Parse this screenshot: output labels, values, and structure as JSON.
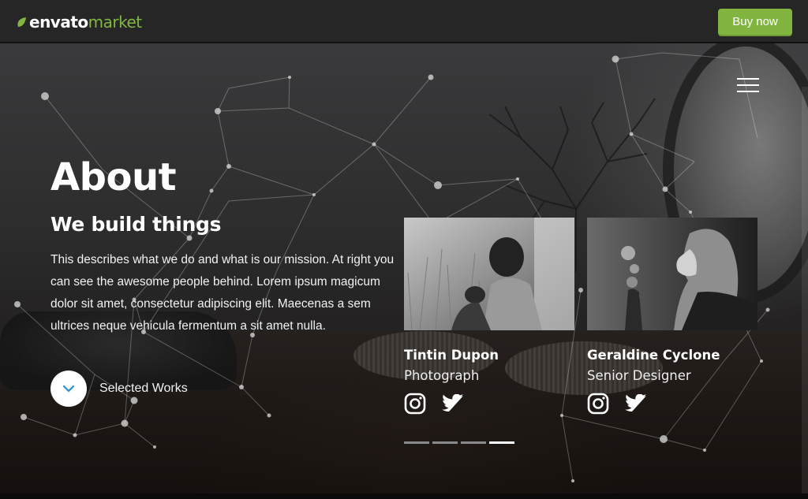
{
  "topbar": {
    "brand_main": "envato",
    "brand_accent": "market",
    "buy_label": "Buy now",
    "accent_color": "#82b440"
  },
  "hero": {
    "title": "About",
    "subtitle": "We build things",
    "description": "This describes what we do and what is our mission. At right you can see the awesome people behind. Lorem ipsum magicum dolor sit amet, consectetur adipiscing elit. Maecenas a sem ultrices neque vehicula fermentum a sit amet nulla.",
    "works_label": "Selected Works",
    "menu_icon": "hamburger-icon"
  },
  "team": [
    {
      "name": "Tintin Dupon",
      "role": "Photograph",
      "socials": [
        "instagram-icon",
        "twitter-icon"
      ]
    },
    {
      "name": "Geraldine Cyclone",
      "role": "Senior Designer",
      "socials": [
        "instagram-icon",
        "twitter-icon"
      ]
    }
  ],
  "slider": {
    "count": 4,
    "active_index": 3
  }
}
